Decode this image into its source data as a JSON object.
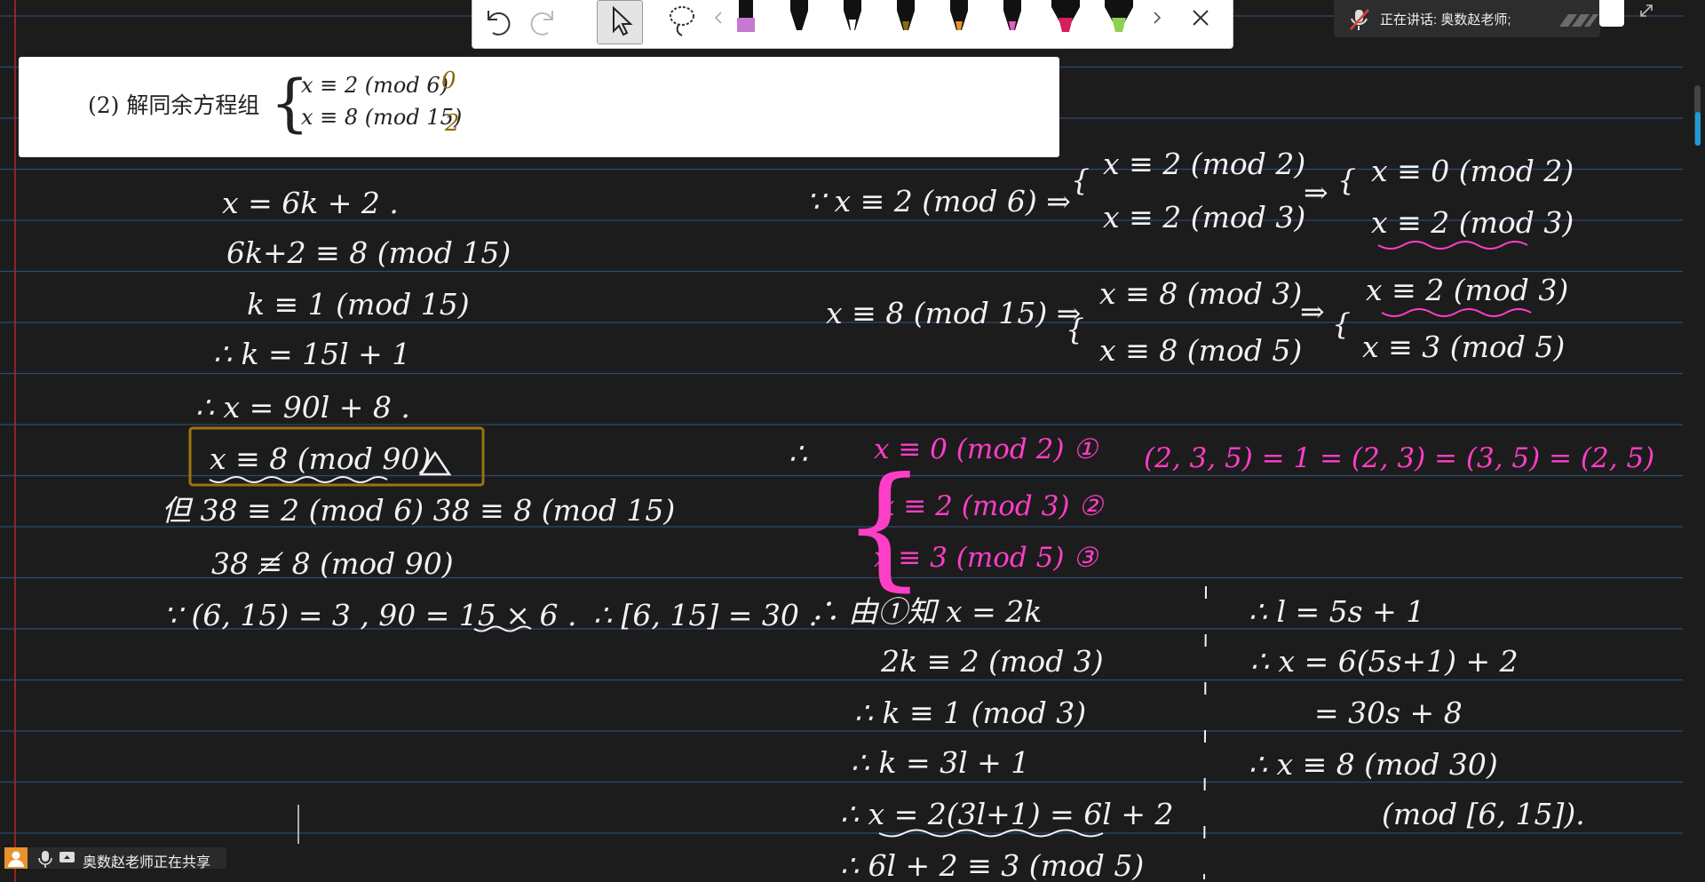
{
  "problem": {
    "label": "(2)  解同余方程组",
    "eq1": "x ≡ 2  (mod 6)",
    "eq2": "x ≡ 8  (mod 15)",
    "mark1": "0",
    "mark2": "2"
  },
  "toolbar": {
    "tools": [
      "undo-icon",
      "redo-icon",
      "select-icon",
      "lasso-icon",
      "prev-icon",
      "purple-marker",
      "black-pen",
      "white-pen",
      "brown-pen",
      "orange-pen",
      "pink-pen",
      "red-highlighter",
      "green-highlighter",
      "next-icon",
      "close-icon"
    ],
    "pen_colors": [
      "#c779d0",
      "#111111",
      "#ffffff",
      "#8a6a10",
      "#e8912d",
      "#e85ac8",
      "#d81e5b",
      "#8fd14f"
    ]
  },
  "speaking": {
    "text": "正在讲话:   奥数赵老师;"
  },
  "share": {
    "text": "奥数赵老师正在共享"
  },
  "notes_left": [
    "x = 6k + 2 .",
    "6k+2 ≡ 8   (mod 15)",
    "k ≡ 1   (mod 15)",
    "∴ k = 15l + 1",
    "∴  x = 90l + 8 .",
    "x ≡ 8  (mod 90)",
    "但  38 ≡ 2   (mod 6)      38 ≡ 8   (mod 15)",
    "38 ≢ 8   (mod 90)",
    "∵   (6, 15) = 3 ,     90 = 15 × 6 .",
    "∴ [6, 15] = 30 ."
  ],
  "notes_right_top": {
    "r1": "∵ x ≡ 2  (mod 6)  ⇒",
    "r1a": "x ≡ 2    (mod 2)",
    "r1b": "x ≡ 2    (mod 3)",
    "r1c": "⇒",
    "r1d": "x ≡ 0  (mod 2)",
    "r1e": "x ≡ 2  (mod 3)",
    "r2": "x ≡ 8   (mod 15) ⇒",
    "r2a": "x ≡ 8    (mod 3)",
    "r2b": "x ≡ 8    (mod 5)",
    "r2c": "⇒",
    "r2d": "x ≡ 2  (mod 3)",
    "r2e": "x ≡ 3   (mod 5)"
  },
  "notes_pink": {
    "therefore": "∴",
    "s1": "x ≡ 0    (mod 2)  ①",
    "s2": "x ≡ 2     (mod 3)  ②",
    "s3": "x ≡ 3     (mod 5) ③",
    "gcd": "(2, 3, 5) = 1 = (2, 3) = (3, 5) = (2, 5)"
  },
  "notes_mid": [
    "∴ 由①知     x = 2k",
    "2k ≡ 2   (mod 3)",
    "∴  k ≡ 1   (mod 3)",
    "∴  k = 3l + 1",
    "∴  x = 2(3l+1) = 6l + 2",
    "∴ 6l + 2 ≡ 3   (mod 5)"
  ],
  "notes_far_right": [
    "∴  l = 5s + 1",
    "∴  x = 6(5s+1) + 2",
    "= 30s + 8",
    "∴  x ≡ 8    (mod 30)",
    "(mod [6, 15])."
  ]
}
